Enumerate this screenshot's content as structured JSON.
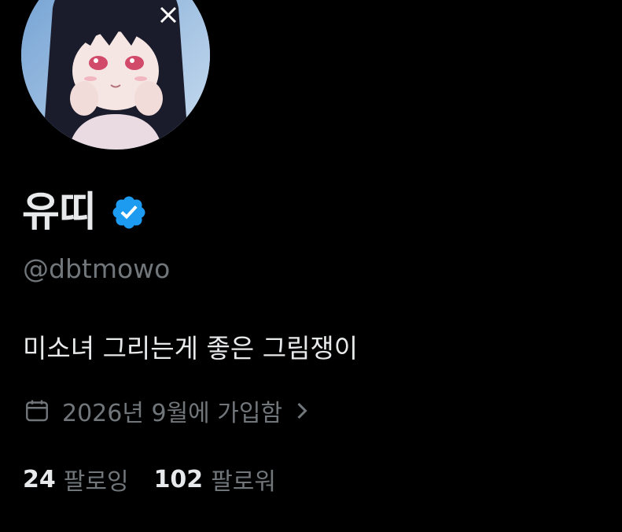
{
  "profile": {
    "display_name": "유띠",
    "handle": "@dbtmowo",
    "bio": "미소녀 그리는게 좋은 그림쟁이",
    "joined": "2026년 9월에 가입함",
    "verified_badge_color": "#1d9bf0"
  },
  "stats": {
    "following_count": "24",
    "following_label": "팔로잉",
    "followers_count": "102",
    "followers_label": "팔로워"
  },
  "icons": {
    "verified": "verified-badge-icon",
    "calendar": "calendar-icon",
    "chevron": "chevron-right-icon"
  },
  "colors": {
    "background": "#000000",
    "primary_text": "#e7e9ea",
    "secondary_text": "#71767b",
    "accent": "#1d9bf0"
  }
}
